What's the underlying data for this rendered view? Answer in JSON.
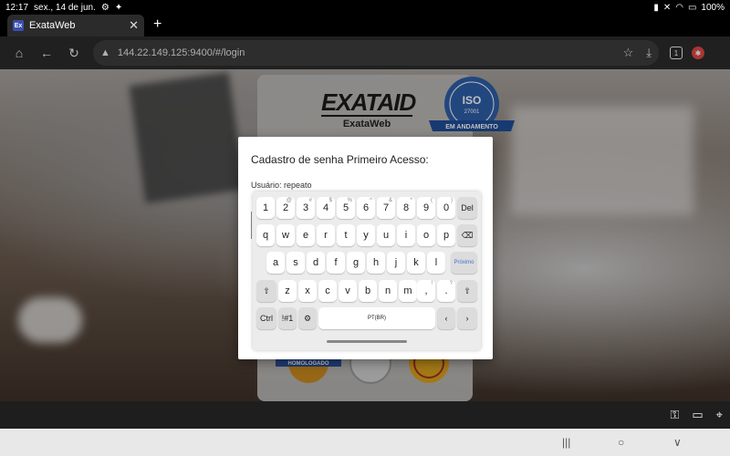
{
  "status_bar": {
    "time": "12:17",
    "date": "sex., 14 de jun.",
    "battery": "100%"
  },
  "tab": {
    "favicon_text": "Ex",
    "title": "ExataWeb"
  },
  "toolbar": {
    "url": "144.22.149.125:9400/#/login",
    "tab_count": "1"
  },
  "brand": {
    "logo": "EXATAID",
    "subtitle": "ExataWeb"
  },
  "iso_seal": {
    "arc_text": "EM ANDAMENTO",
    "center_text": "ISO",
    "number": "27001"
  },
  "seals": {
    "left_banner": "HOMOLOGADO"
  },
  "dialog": {
    "title": "Cadastro de senha Primeiro Acesso:",
    "user_label": "Usuário: repeato"
  },
  "keyboard": {
    "row1": [
      {
        "main": "1",
        "hint": ""
      },
      {
        "main": "2",
        "hint": "@"
      },
      {
        "main": "3",
        "hint": "#"
      },
      {
        "main": "4",
        "hint": "$"
      },
      {
        "main": "5",
        "hint": "%"
      },
      {
        "main": "6",
        "hint": "^"
      },
      {
        "main": "7",
        "hint": "&"
      },
      {
        "main": "8",
        "hint": "*"
      },
      {
        "main": "9",
        "hint": "("
      },
      {
        "main": "0",
        "hint": ")"
      }
    ],
    "del_label": "Del",
    "row2": [
      "q",
      "w",
      "e",
      "r",
      "t",
      "y",
      "u",
      "i",
      "o",
      "p"
    ],
    "row3": [
      "a",
      "s",
      "d",
      "f",
      "g",
      "h",
      "j",
      "k",
      "l"
    ],
    "enter_label": "Próximo",
    "row4": [
      "z",
      "x",
      "c",
      "v",
      "b",
      "n",
      "m"
    ],
    "comma_hint": "!",
    "period_hint": "?",
    "ctrl_label": "Ctrl",
    "symbols_label": "!#1",
    "space_label": "PT(BR)"
  }
}
